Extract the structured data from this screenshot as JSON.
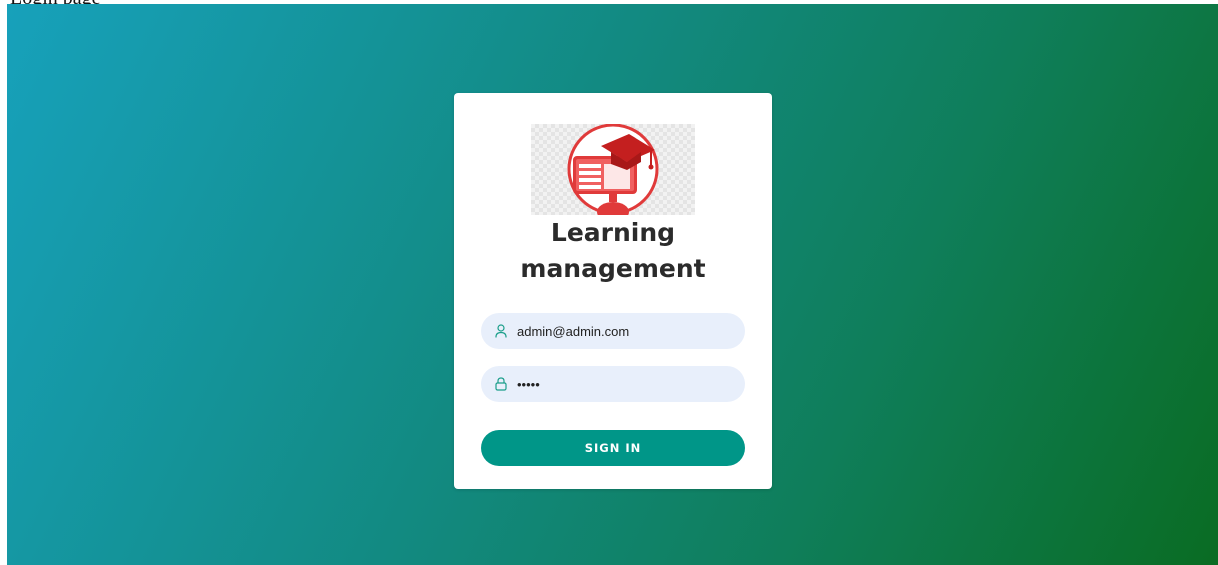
{
  "page": {
    "heading": "Login page"
  },
  "login": {
    "title_line1": "Learning",
    "title_line2": "management",
    "email": {
      "value": "admin@admin.com",
      "icon": "user-icon"
    },
    "password": {
      "value": "admin",
      "icon": "lock-icon"
    },
    "signin_label": "SIGN IN"
  },
  "colors": {
    "gradient_start": "#17a1bb",
    "gradient_end": "#0a6c23",
    "button": "#009688",
    "input_bg": "#e8effb",
    "logo_red": "#e03a3a"
  }
}
